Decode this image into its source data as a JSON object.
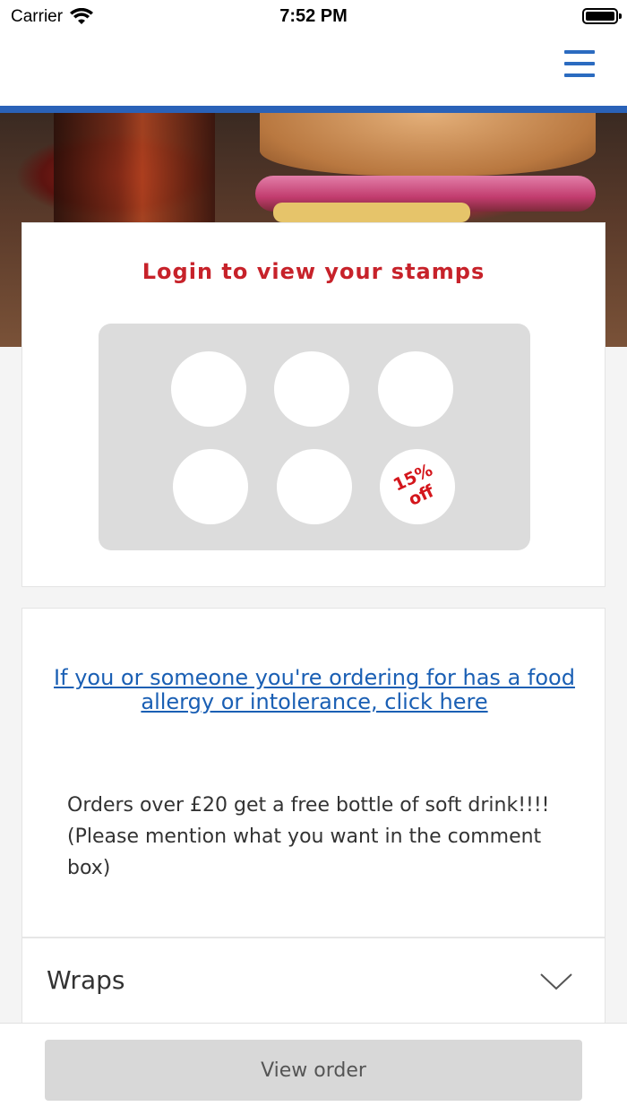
{
  "status_bar": {
    "carrier": "Carrier",
    "time": "7:52 PM"
  },
  "header": {
    "menu_icon": "hamburger-menu-icon",
    "accent_color": "#2a62b8"
  },
  "hero": {
    "image": "burger-and-cola-photo"
  },
  "stamps": {
    "title": "Login to view your stamps",
    "reward_label_line1": "15%",
    "reward_label_line2": "off",
    "title_color": "#c7222a"
  },
  "info": {
    "allergy_link": "If you or someone you're ordering for has a food allergy or intolerance, click here",
    "promo": "Orders over £20 get a free bottle of soft drink!!!! (Please mention what you want in the comment box)",
    "link_color": "#1a5fb4"
  },
  "menu": {
    "categories": [
      {
        "label": "Wraps",
        "icon": "chevron-down-icon"
      }
    ]
  },
  "footer": {
    "view_order_label": "View order"
  }
}
